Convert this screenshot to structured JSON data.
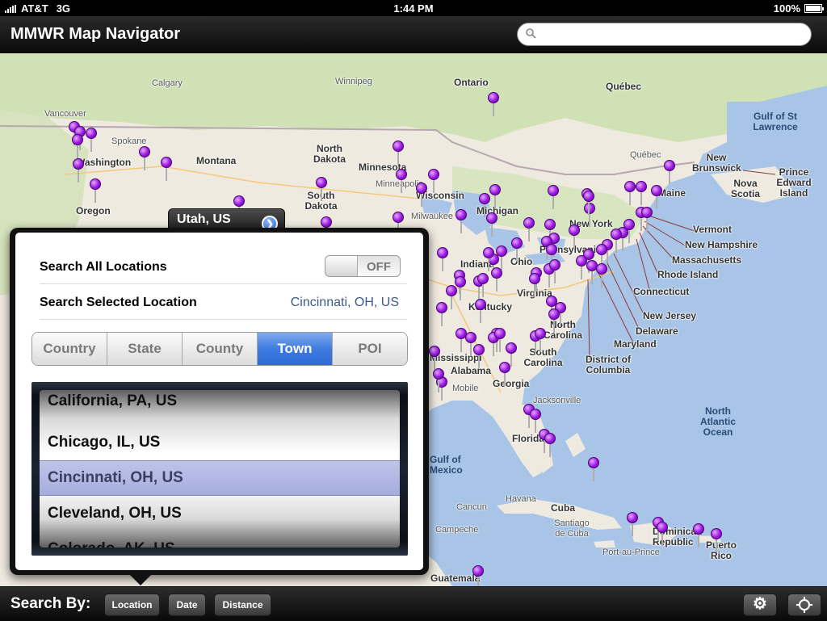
{
  "status_bar": {
    "carrier": "AT&T",
    "network": "3G",
    "time": "1:44 PM",
    "battery": "100%"
  },
  "nav": {
    "title": "MMWR Map Navigator",
    "search_icon": "search-icon",
    "search_placeholder": "",
    "search_value": ""
  },
  "map": {
    "callout": {
      "label": "Utah, US",
      "icon": "disclosure-arrow-icon"
    },
    "labels": [
      "Calgary",
      "Ontario",
      "Québec",
      "Gulf of St Lawrence",
      "Vancouver",
      "Winnipeg",
      "Spokane",
      "Washington",
      "Montana",
      "North Dakota",
      "Minnesota",
      "Québec",
      "New Brunswick",
      "Prince Edward Island",
      "Nova Scotia",
      "Maine",
      "Oregon",
      "South Dakota",
      "Wisconsin",
      "Minneapolis",
      "Milwaukee",
      "Michigan",
      "New York",
      "Vermont",
      "New Hampshire",
      "Massachusetts",
      "Rhode Island",
      "Connecticut",
      "Indiana",
      "Ohio",
      "Pennsylvania",
      "Virginia",
      "Kentucky",
      "New Jersey",
      "Delaware",
      "Maryland",
      "North Carolina",
      "South Carolina",
      "Mississippi",
      "Alabama",
      "Georgia",
      "District of Columbia",
      "Mobile",
      "Jacksonville",
      "Florida",
      "North Atlantic Ocean",
      "Gulf of Mexico",
      "Havana",
      "Cuba",
      "Cancun",
      "Campeche",
      "Santiago de Cuba",
      "Dominican Republic",
      "Port-au-Prince",
      "Puerto Rico",
      "Guatemala"
    ]
  },
  "popover": {
    "search_all_label": "Search All Locations",
    "search_all_toggle": "OFF",
    "search_selected_label": "Search Selected Location",
    "search_selected_value": "Cincinnati, OH, US",
    "segments": [
      "Country",
      "State",
      "County",
      "Town",
      "POI"
    ],
    "active_segment": "Town",
    "picker_items": [
      "California, PA, US",
      "Chicago, IL, US",
      "Cincinnati, OH, US",
      "Cleveland, OH, US",
      "Colorado, AK, US"
    ],
    "selected_item": "Cincinnati, OH, US"
  },
  "toolbar": {
    "search_by_label": "Search By:",
    "buttons": [
      "Location",
      "Date",
      "Distance"
    ],
    "settings_icon": "gear-icon",
    "locate_icon": "locate-icon"
  },
  "colors": {
    "pin": "#9a18e0",
    "segment_active": "#3f7ce0",
    "map_water": "#a8c4e6",
    "map_land": "#efeae0",
    "map_forest": "#cfe1b5"
  }
}
